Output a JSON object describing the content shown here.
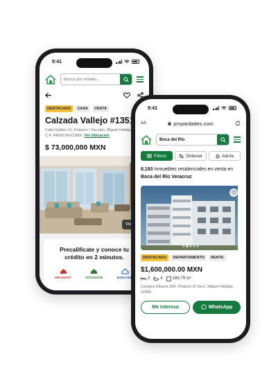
{
  "colors": {
    "brand_green": "#157a3d",
    "badge_yellow": "#f4c23a",
    "phone_frame": "#1c1c1e"
  },
  "phone1": {
    "status_time": "9:41",
    "search_placeholder": "Busca por estado...",
    "icons": [
      "house-logo-icon",
      "search-icon",
      "menu-icon",
      "back-arrow-icon",
      "heart-icon",
      "share-icon"
    ],
    "tags": [
      "DESTACADO",
      "CASA",
      "VENTA"
    ],
    "title": "Calzada Vallejo #1351",
    "address_line1": "Calle Galileo #1, Polanco I Sección, Miguel Hidalgo,",
    "address_line2": "C.P. 44600 DF/CDMX",
    "map_link": "Ver Ubicación",
    "price": "$ 73,000,000 MXN",
    "gallery_button": "Ver galería",
    "credit_title": "Precalifícate y conoce tu crédito en 2 minutos.",
    "credit_options": [
      "INFONAVIT",
      "FOVISSSTE",
      "BANCARIO"
    ]
  },
  "phone2": {
    "status_time": "9:41",
    "url_text": "propiedades.com",
    "aa_label": "AA",
    "search_value": "Boca del Río",
    "filters": [
      {
        "label": "Filtros",
        "icon": "filter-icon"
      },
      {
        "label": "Ordenar",
        "icon": "sort-icon"
      },
      {
        "label": "Alerta",
        "icon": "bell-icon"
      }
    ],
    "results_count": "8,193",
    "results_text": " Inmuebles residenciales en venta en ",
    "results_location": "Boca del Río Veracruz",
    "tags": [
      "DESTACADO",
      "DEPARTAMENTO",
      "RENTA"
    ],
    "price": "$1,600,000.00 MXN",
    "bedrooms": "2",
    "bathrooms": "4",
    "area": "166.79 m²",
    "address": "Campos Eliseos 369, Polanco III Secc, Miguel Hidalgo, 11550",
    "cta_interest": "Me interesa",
    "cta_whatsapp": "WhatsApp",
    "carousel_dots": 5,
    "carousel_active": 1
  }
}
